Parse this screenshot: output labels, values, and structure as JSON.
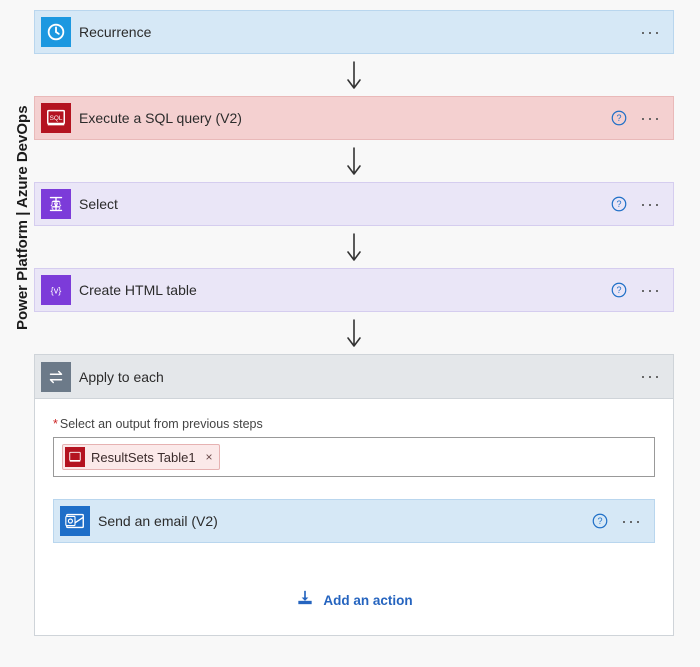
{
  "sidebar": {
    "label": "Power Platform | Azure DevOps"
  },
  "nodes": {
    "recurrence": {
      "title": "Recurrence"
    },
    "sql": {
      "title": "Execute a SQL query (V2)"
    },
    "select": {
      "title": "Select"
    },
    "html_table": {
      "title": "Create HTML table"
    },
    "apply": {
      "title": "Apply to each"
    },
    "email": {
      "title": "Send an email (V2)"
    }
  },
  "foreach": {
    "field_label": "Select an output from previous steps",
    "token_text": "ResultSets Table1"
  },
  "actions": {
    "add": "Add an action"
  }
}
